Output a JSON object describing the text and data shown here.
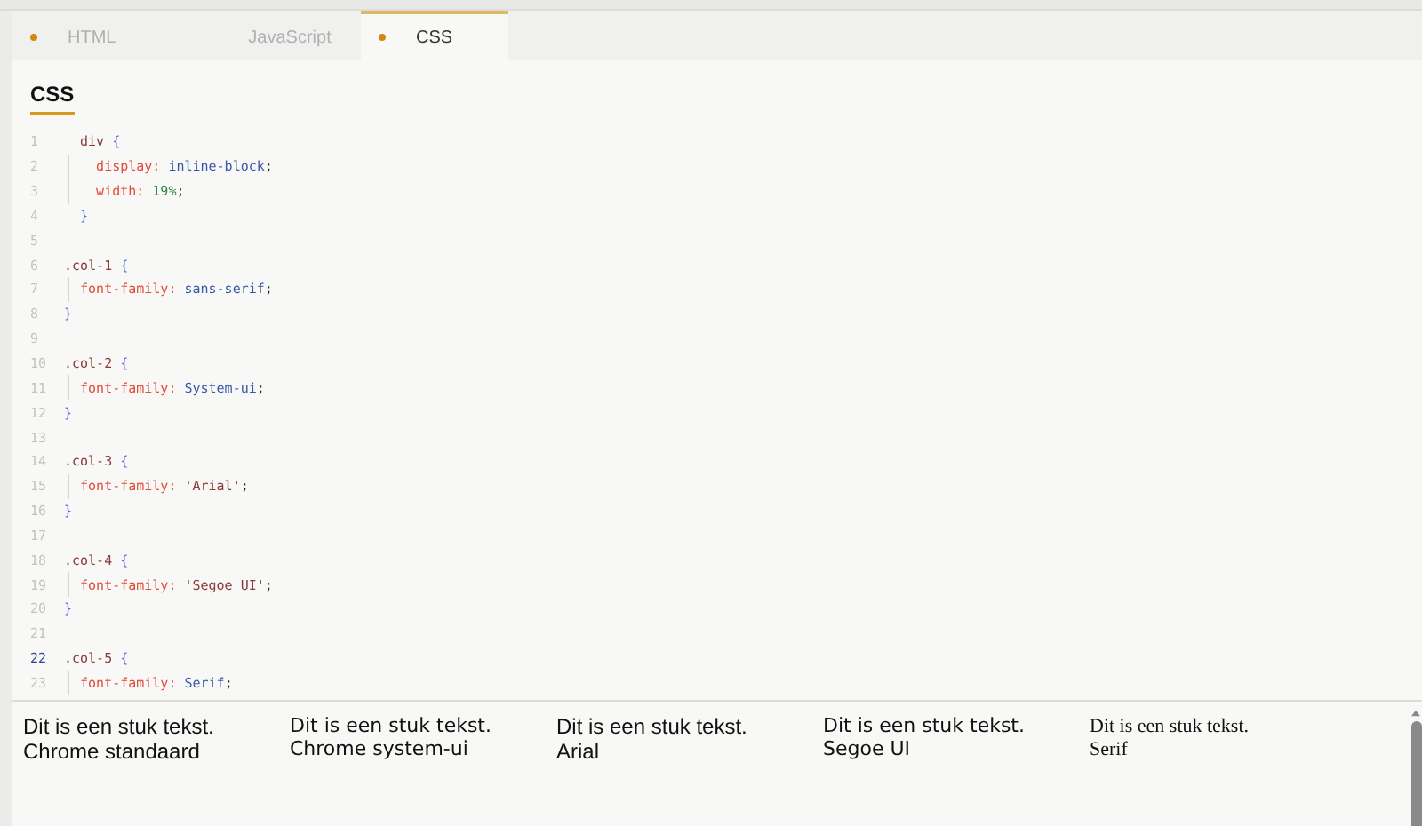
{
  "tabs": [
    {
      "label": "HTML",
      "dot": true,
      "selected": false
    },
    {
      "label": "JavaScript",
      "dot": false,
      "selected": false
    },
    {
      "label": "CSS",
      "dot": true,
      "selected": true
    }
  ],
  "editor": {
    "title": "CSS",
    "lines": [
      {
        "number": "1",
        "active": false,
        "tokens": [
          {
            "kind": "selector",
            "text": "  div "
          },
          {
            "kind": "brace",
            "text": "{"
          }
        ]
      },
      {
        "number": "2",
        "active": false,
        "tokens": [
          {
            "kind": "prop",
            "text": "    display: "
          },
          {
            "kind": "value",
            "text": "inline-block"
          },
          {
            "kind": "punct",
            "text": ";"
          }
        ]
      },
      {
        "number": "3",
        "active": false,
        "tokens": [
          {
            "kind": "prop",
            "text": "    width: "
          },
          {
            "kind": "number",
            "text": "19%"
          },
          {
            "kind": "punct",
            "text": ";"
          }
        ]
      },
      {
        "number": "4",
        "active": false,
        "tokens": [
          {
            "kind": "brace",
            "text": "  }"
          }
        ]
      },
      {
        "number": "5",
        "active": false
      },
      {
        "number": "6",
        "active": false,
        "tokens": [
          {
            "kind": "selector",
            "text": ".col-1 "
          },
          {
            "kind": "brace",
            "text": "{"
          }
        ]
      },
      {
        "number": "7",
        "active": false,
        "tokens": [
          {
            "kind": "prop",
            "text": "  font-family: "
          },
          {
            "kind": "value",
            "text": "sans-serif"
          },
          {
            "kind": "punct",
            "text": ";"
          }
        ]
      },
      {
        "number": "8",
        "active": false,
        "tokens": [
          {
            "kind": "brace",
            "text": "}"
          }
        ]
      },
      {
        "number": "9",
        "active": false
      },
      {
        "number": "10",
        "active": false,
        "tokens": [
          {
            "kind": "selector",
            "text": ".col-2 "
          },
          {
            "kind": "brace",
            "text": "{"
          }
        ]
      },
      {
        "number": "11",
        "active": false,
        "tokens": [
          {
            "kind": "prop",
            "text": "  font-family: "
          },
          {
            "kind": "value",
            "text": "System-ui"
          },
          {
            "kind": "punct",
            "text": ";"
          }
        ]
      },
      {
        "number": "12",
        "active": false,
        "tokens": [
          {
            "kind": "brace",
            "text": "}"
          }
        ]
      },
      {
        "number": "13",
        "active": false
      },
      {
        "number": "14",
        "active": false,
        "tokens": [
          {
            "kind": "selector",
            "text": ".col-3 "
          },
          {
            "kind": "brace",
            "text": "{"
          }
        ]
      },
      {
        "number": "15",
        "active": false,
        "tokens": [
          {
            "kind": "prop",
            "text": "  font-family: "
          },
          {
            "kind": "string",
            "text": "'Arial'"
          },
          {
            "kind": "punct",
            "text": ";"
          }
        ]
      },
      {
        "number": "16",
        "active": false,
        "tokens": [
          {
            "kind": "brace",
            "text": "}"
          }
        ]
      },
      {
        "number": "17",
        "active": false
      },
      {
        "number": "18",
        "active": false,
        "tokens": [
          {
            "kind": "selector",
            "text": ".col-4 "
          },
          {
            "kind": "brace",
            "text": "{"
          }
        ]
      },
      {
        "number": "19",
        "active": false,
        "tokens": [
          {
            "kind": "prop",
            "text": "  font-family: "
          },
          {
            "kind": "string",
            "text": "'Segoe UI'"
          },
          {
            "kind": "punct",
            "text": ";"
          }
        ]
      },
      {
        "number": "20",
        "active": false,
        "tokens": [
          {
            "kind": "brace",
            "text": "}"
          }
        ]
      },
      {
        "number": "21",
        "active": false
      },
      {
        "number": "22",
        "active": true,
        "tokens": [
          {
            "kind": "selector",
            "text": ".col-5 "
          },
          {
            "kind": "brace",
            "text": "{"
          }
        ]
      },
      {
        "number": "23",
        "active": false,
        "tokens": [
          {
            "kind": "prop",
            "text": "  font-family: "
          },
          {
            "kind": "value",
            "text": "Serif"
          },
          {
            "kind": "punct",
            "text": ";"
          }
        ]
      }
    ]
  },
  "preview": [
    {
      "kind": "sans",
      "text": "Dit is een stuk tekst.",
      "caption": "Chrome standaard"
    },
    {
      "kind": "system",
      "text": "Dit is een stuk tekst.",
      "caption": "Chrome system-ui"
    },
    {
      "kind": "arial",
      "text": "Dit is een stuk tekst.",
      "caption": "Arial"
    },
    {
      "kind": "segoe",
      "text": "Dit is een stuk tekst.",
      "caption": "Segoe UI"
    },
    {
      "kind": "serif",
      "text": "Dit is een stuk tekst.",
      "caption": "Serif"
    }
  ]
}
